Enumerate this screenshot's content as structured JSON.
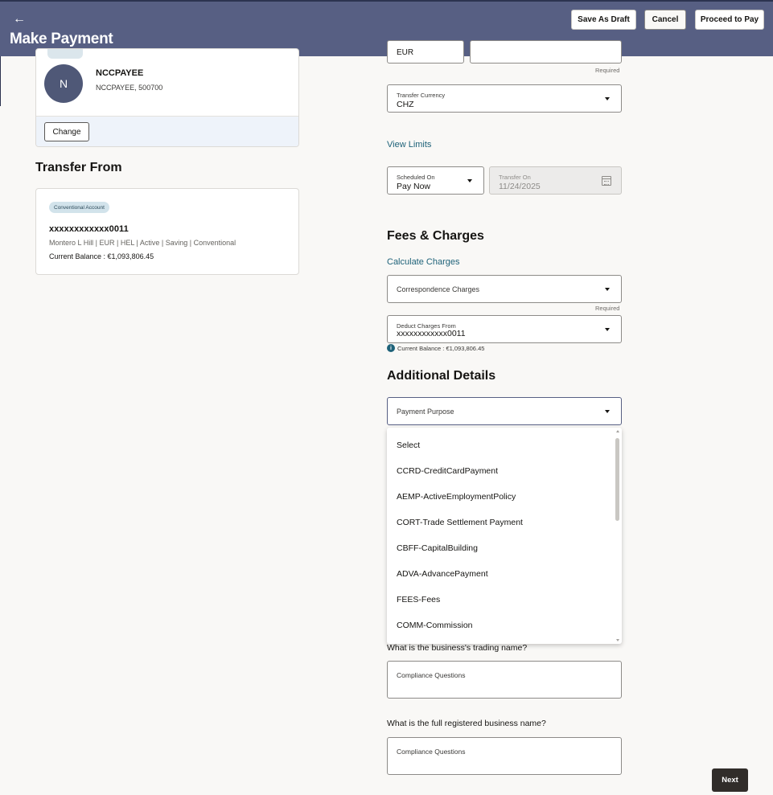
{
  "header": {
    "back_icon": "back-arrow-icon",
    "back_glyph": "←",
    "title": "Make Payment",
    "buttons": {
      "save_draft": "Save As Draft",
      "cancel": "Cancel",
      "proceed": "Proceed to Pay"
    },
    "colors": {
      "background": "#575f83",
      "text": "#ffffff"
    }
  },
  "payee": {
    "avatar_initial": "N",
    "name": "NCCPAYEE",
    "details": "NCCPAYEE, 500700",
    "change_label": "Change"
  },
  "transfer_from": {
    "heading": "Transfer From",
    "badge": "Conventional Account",
    "account_number": "xxxxxxxxxxxx0011",
    "account_info": "Montero L Hill | EUR | HEL | Active | Saving | Conventional",
    "current_balance": "Current Balance : €1,093,806.45"
  },
  "amount": {
    "currency_partial": "EUR",
    "required_label": "Required"
  },
  "transfer_currency": {
    "label": "Transfer Currency",
    "value": "CHZ"
  },
  "view_limits": "View Limits",
  "schedule": {
    "scheduled_on_label": "Scheduled On",
    "scheduled_on_value": "Pay Now",
    "transfer_on_label": "Transfer On",
    "transfer_on_value": "11/24/2025",
    "calendar_icon": "calendar-icon"
  },
  "fees": {
    "heading": "Fees & Charges",
    "calculate_link": "Calculate Charges",
    "correspondence_placeholder": "Correspondence Charges",
    "required_label": "Required",
    "deduct_label": "Deduct Charges From",
    "deduct_value": "xxxxxxxxxxxx0011",
    "balance_note": "Current Balance : €1,093,806.45",
    "info_icon": "info-icon",
    "info_glyph": "i"
  },
  "additional": {
    "heading": "Additional Details",
    "purpose_placeholder": "Payment Purpose",
    "options": [
      "Select",
      "CCRD-CreditCardPayment",
      "AEMP-ActiveEmploymentPolicy",
      "CORT-Trade Settlement Payment",
      "CBFF-CapitalBuilding",
      "ADVA-AdvancePayment",
      "FEES-Fees",
      "COMM-Commission"
    ]
  },
  "compliance": {
    "q1": "What is the business's trading name?",
    "q1_placeholder": "Compliance Questions",
    "q2": "What is the full registered business name?",
    "q2_placeholder": "Compliance Questions"
  },
  "next_label": "Next"
}
